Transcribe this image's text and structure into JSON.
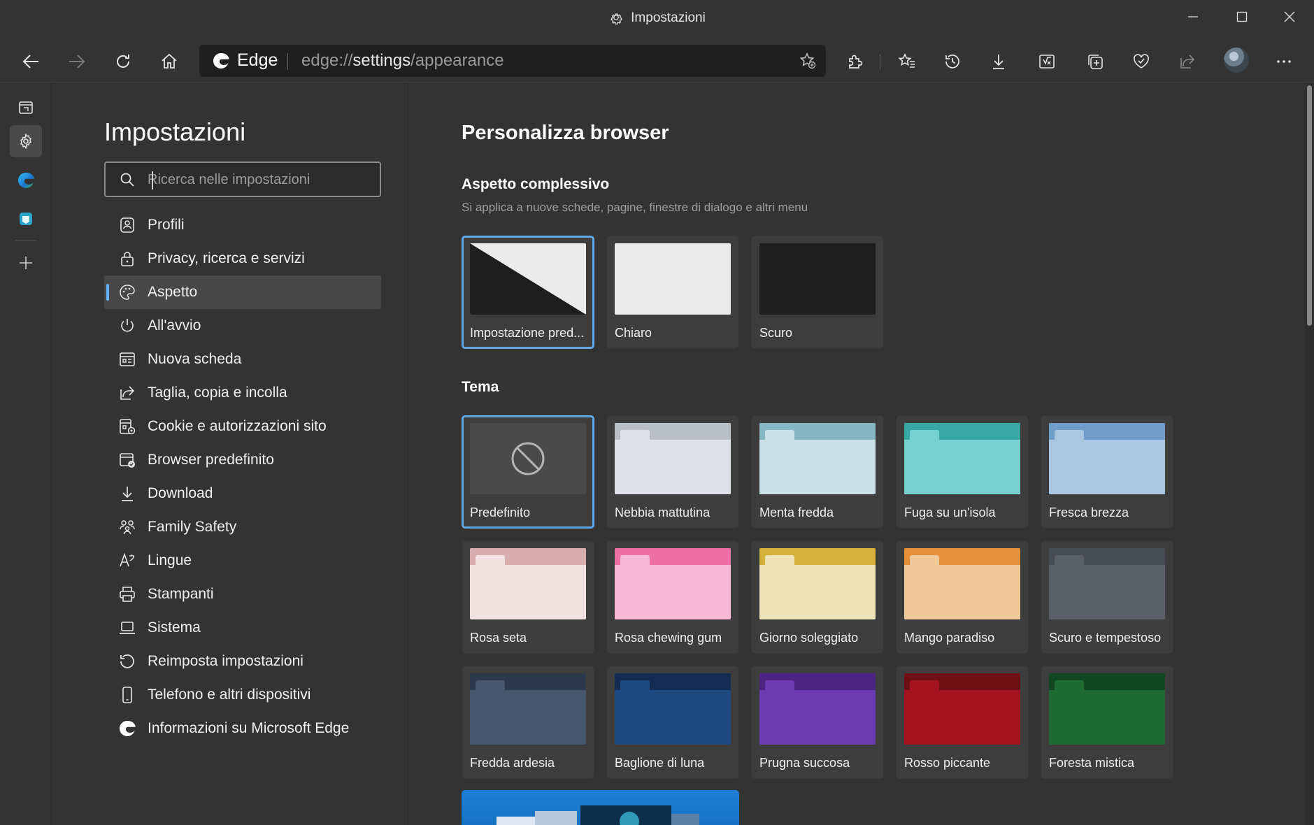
{
  "window": {
    "title": "Impostazioni"
  },
  "toolbar": {
    "brand": "Edge",
    "url_prefix": "edge://",
    "url_host": "settings",
    "url_path": "/appearance"
  },
  "sidebar": {
    "title": "Impostazioni",
    "search_placeholder": "Ricerca nelle impostazioni",
    "items": [
      {
        "label": "Profili",
        "icon": "profile-icon"
      },
      {
        "label": "Privacy, ricerca e servizi",
        "icon": "lock-icon"
      },
      {
        "label": "Aspetto",
        "icon": "palette-icon",
        "active": true
      },
      {
        "label": "All'avvio",
        "icon": "power-icon"
      },
      {
        "label": "Nuova scheda",
        "icon": "new-tab-icon"
      },
      {
        "label": "Taglia, copia e incolla",
        "icon": "share-icon"
      },
      {
        "label": "Cookie e autorizzazioni sito",
        "icon": "cookie-settings-icon"
      },
      {
        "label": "Browser predefinito",
        "icon": "default-browser-icon"
      },
      {
        "label": "Download",
        "icon": "download-icon"
      },
      {
        "label": "Family Safety",
        "icon": "family-icon"
      },
      {
        "label": "Lingue",
        "icon": "language-icon"
      },
      {
        "label": "Stampanti",
        "icon": "printer-icon"
      },
      {
        "label": "Sistema",
        "icon": "laptop-icon"
      },
      {
        "label": "Reimposta impostazioni",
        "icon": "reset-icon"
      },
      {
        "label": "Telefono e altri dispositivi",
        "icon": "phone-icon"
      },
      {
        "label": "Informazioni su Microsoft Edge",
        "icon": "edge-logo-icon"
      }
    ]
  },
  "main": {
    "title": "Personalizza browser",
    "overall": {
      "heading": "Aspetto complessivo",
      "description": "Si applica a nuove schede, pagine, finestre di dialogo e altri menu",
      "options": [
        {
          "label": "Impostazione pred...",
          "selected": true
        },
        {
          "label": "Chiaro"
        },
        {
          "label": "Scuro"
        }
      ]
    },
    "theme": {
      "heading": "Tema",
      "options": [
        {
          "label": "Predefinito",
          "selected": true,
          "back": "#4a4a4a",
          "front": "#4a4a4a"
        },
        {
          "label": "Nebbia mattutina",
          "back": "#b9bec4",
          "front": "#dfe2e6"
        },
        {
          "label": "Menta fredda",
          "back": "#87b7c2",
          "front": "#c9e1e6"
        },
        {
          "label": "Fuga su un'isola",
          "back": "#3aa6a6",
          "front": "#76d2d2"
        },
        {
          "label": "Fresca brezza",
          "back": "#6f9cc8",
          "front": "#aac7e2"
        },
        {
          "label": "Rosa seta",
          "back": "#d9aeae",
          "front": "#f1e1e1"
        },
        {
          "label": "Rosa chewing gum",
          "back": "#ee6fa3",
          "front": "#f7b9d3"
        },
        {
          "label": "Giorno soleggiato",
          "back": "#d4b23a",
          "front": "#ede2b8"
        },
        {
          "label": "Mango paradiso",
          "back": "#e6903a",
          "front": "#f0c99a"
        },
        {
          "label": "Scuro e tempestoso",
          "back": "#474b52",
          "front": "#5b5f66"
        },
        {
          "label": "Fredda ardesia",
          "back": "#2c394b",
          "front": "#46566b"
        },
        {
          "label": "Baglione di luna",
          "back": "#132c52",
          "front": "#1e4a82"
        },
        {
          "label": "Prugna succosa",
          "back": "#4b2482",
          "front": "#6c3bb0"
        },
        {
          "label": "Rosso piccante",
          "back": "#6e0f16",
          "front": "#a3141f"
        },
        {
          "label": "Foresta mistica",
          "back": "#114623",
          "front": "#206b34"
        }
      ]
    }
  },
  "colors": {
    "accent": "#5da9e9",
    "active_indicator": "#60b4ff"
  }
}
